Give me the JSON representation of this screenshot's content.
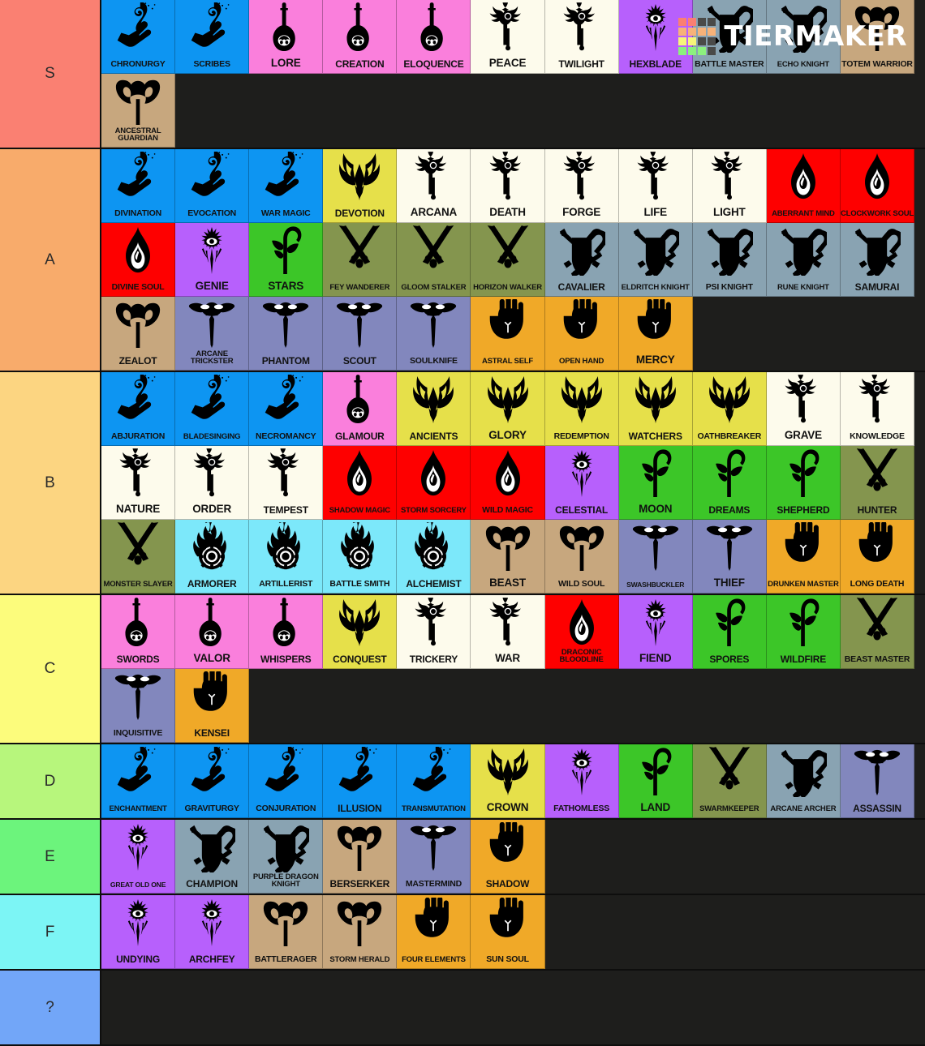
{
  "app": {
    "brand": "TIERMAKER",
    "brand_icon": "tiermaker-logo-grid",
    "logo_grid_colors": [
      "#fa7f72",
      "#fa7f72",
      "#4a4a48",
      "#4a4a48",
      "#f7b279",
      "#f7b279",
      "#f7b279",
      "#f7b279",
      "#f7f579",
      "#f7f579",
      "#4a4a48",
      "#4a4a48",
      "#8cf07e",
      "#8cf07e",
      "#8cf07e",
      "#4a4a48"
    ],
    "background": "#1e1e1c"
  },
  "palette": {
    "wizard": "#0d95f2",
    "bard": "#fa7fdc",
    "cleric": "#fdfbec",
    "warlock": "#b760fc",
    "fighter": "#89a3b2",
    "barbarian": "#c7a77e",
    "paladin": "#e6e04a",
    "sorcerer": "#fe0000",
    "ranger": "#84954e",
    "rogue": "#8287bd",
    "monk": "#f0a928",
    "druid": "#3cc628",
    "artificer": "#7ce8fa"
  },
  "tier_colors": {
    "S": "#fa8072",
    "A": "#f8ab6b",
    "B": "#fcd581",
    "C": "#fcfc7c",
    "D": "#b7f67c",
    "E": "#6cf47c",
    "F": "#7cf5f5",
    "?": "#72a6f8"
  },
  "tiers": [
    {
      "label": "S",
      "color_key": "S",
      "items": [
        {
          "name": "CHRONURGY",
          "class_key": "wizard",
          "icon": "wizard-hand-icon",
          "size": "s3"
        },
        {
          "name": "SCRIBES",
          "class_key": "wizard",
          "icon": "wizard-hand-icon",
          "size": "s3"
        },
        {
          "name": "LORE",
          "class_key": "bard",
          "icon": "bard-lute-icon",
          "size": "s1"
        },
        {
          "name": "CREATION",
          "class_key": "bard",
          "icon": "bard-lute-icon",
          "size": "s2"
        },
        {
          "name": "ELOQUENCE",
          "class_key": "bard",
          "icon": "bard-lute-icon",
          "size": "s2"
        },
        {
          "name": "PEACE",
          "class_key": "cleric",
          "icon": "cleric-mace-icon",
          "size": "s1"
        },
        {
          "name": "TWILIGHT",
          "class_key": "cleric",
          "icon": "cleric-mace-icon",
          "size": "s2"
        },
        {
          "name": "HEXBLADE",
          "class_key": "warlock",
          "icon": "warlock-eye-icon",
          "size": "s2"
        },
        {
          "name": "BATTLE MASTER",
          "class_key": "fighter",
          "icon": "fighter-shield-icon",
          "size": "s3"
        },
        {
          "name": "ECHO KNIGHT",
          "class_key": "fighter",
          "icon": "fighter-shield-icon",
          "size": "s4"
        },
        {
          "name": "TOTEM WARRIOR",
          "class_key": "barbarian",
          "icon": "barbarian-axe-icon",
          "size": "s3"
        },
        {
          "name": "ANCESTRAL GUARDIAN",
          "class_key": "barbarian",
          "icon": "barbarian-axe-icon",
          "size": "s4"
        }
      ]
    },
    {
      "label": "A",
      "color_key": "A",
      "items": [
        {
          "name": "DIVINATION",
          "class_key": "wizard",
          "icon": "wizard-hand-icon",
          "size": "s3"
        },
        {
          "name": "EVOCATION",
          "class_key": "wizard",
          "icon": "wizard-hand-icon",
          "size": "s3"
        },
        {
          "name": "WAR MAGIC",
          "class_key": "wizard",
          "icon": "wizard-hand-icon",
          "size": "s3"
        },
        {
          "name": "DEVOTION",
          "class_key": "paladin",
          "icon": "paladin-helm-icon",
          "size": "s2"
        },
        {
          "name": "ARCANA",
          "class_key": "cleric",
          "icon": "cleric-mace-icon",
          "size": "s1"
        },
        {
          "name": "DEATH",
          "class_key": "cleric",
          "icon": "cleric-mace-icon",
          "size": "s1"
        },
        {
          "name": "FORGE",
          "class_key": "cleric",
          "icon": "cleric-mace-icon",
          "size": "s1"
        },
        {
          "name": "LIFE",
          "class_key": "cleric",
          "icon": "cleric-mace-icon",
          "size": "s1"
        },
        {
          "name": "LIGHT",
          "class_key": "cleric",
          "icon": "cleric-mace-icon",
          "size": "s1"
        },
        {
          "name": "ABERRANT MIND",
          "class_key": "sorcerer",
          "icon": "sorcerer-flame-icon",
          "size": "s4"
        },
        {
          "name": "CLOCKWORK SOUL",
          "class_key": "sorcerer",
          "icon": "sorcerer-flame-icon",
          "size": "s4"
        },
        {
          "name": "DIVINE SOUL",
          "class_key": "sorcerer",
          "icon": "sorcerer-flame-icon",
          "size": "s3"
        },
        {
          "name": "GENIE",
          "class_key": "warlock",
          "icon": "warlock-eye-icon",
          "size": "s1"
        },
        {
          "name": "STARS",
          "class_key": "druid",
          "icon": "druid-staff-icon",
          "size": "s1"
        },
        {
          "name": "FEY WANDERER",
          "class_key": "ranger",
          "icon": "ranger-arrows-icon",
          "size": "s4"
        },
        {
          "name": "GLOOM STALKER",
          "class_key": "ranger",
          "icon": "ranger-arrows-icon",
          "size": "s4"
        },
        {
          "name": "HORIZON WALKER",
          "class_key": "ranger",
          "icon": "ranger-arrows-icon",
          "size": "s4"
        },
        {
          "name": "CAVALIER",
          "class_key": "fighter",
          "icon": "fighter-shield-icon",
          "size": "s2"
        },
        {
          "name": "ELDRITCH KNIGHT",
          "class_key": "fighter",
          "icon": "fighter-shield-icon",
          "size": "s4"
        },
        {
          "name": "PSI KNIGHT",
          "class_key": "fighter",
          "icon": "fighter-shield-icon",
          "size": "s3"
        },
        {
          "name": "RUNE KNIGHT",
          "class_key": "fighter",
          "icon": "fighter-shield-icon",
          "size": "s4"
        },
        {
          "name": "SAMURAI",
          "class_key": "fighter",
          "icon": "fighter-shield-icon",
          "size": "s2"
        },
        {
          "name": "ZEALOT",
          "class_key": "barbarian",
          "icon": "barbarian-axe-icon",
          "size": "s2"
        },
        {
          "name": "ARCANE TRICKSTER",
          "class_key": "rogue",
          "icon": "rogue-dagger-icon",
          "size": "s4"
        },
        {
          "name": "PHANTOM",
          "class_key": "rogue",
          "icon": "rogue-dagger-icon",
          "size": "s2"
        },
        {
          "name": "SCOUT",
          "class_key": "rogue",
          "icon": "rogue-dagger-icon",
          "size": "s2"
        },
        {
          "name": "SOULKNIFE",
          "class_key": "rogue",
          "icon": "rogue-dagger-icon",
          "size": "s3"
        },
        {
          "name": "ASTRAL SELF",
          "class_key": "monk",
          "icon": "monk-fist-icon",
          "size": "s4"
        },
        {
          "name": "OPEN HAND",
          "class_key": "monk",
          "icon": "monk-fist-icon",
          "size": "s4"
        },
        {
          "name": "MERCY",
          "class_key": "monk",
          "icon": "monk-fist-icon",
          "size": "s1"
        }
      ]
    },
    {
      "label": "B",
      "color_key": "B",
      "items": [
        {
          "name": "ABJURATION",
          "class_key": "wizard",
          "icon": "wizard-hand-icon",
          "size": "s3"
        },
        {
          "name": "BLADESINGING",
          "class_key": "wizard",
          "icon": "wizard-hand-icon",
          "size": "s4"
        },
        {
          "name": "NECROMANCY",
          "class_key": "wizard",
          "icon": "wizard-hand-icon",
          "size": "s3"
        },
        {
          "name": "GLAMOUR",
          "class_key": "bard",
          "icon": "bard-lute-icon",
          "size": "s2"
        },
        {
          "name": "ANCIENTS",
          "class_key": "paladin",
          "icon": "paladin-helm-icon",
          "size": "s2"
        },
        {
          "name": "GLORY",
          "class_key": "paladin",
          "icon": "paladin-helm-icon",
          "size": "s1"
        },
        {
          "name": "REDEMPTION",
          "class_key": "paladin",
          "icon": "paladin-helm-icon",
          "size": "s3"
        },
        {
          "name": "WATCHERS",
          "class_key": "paladin",
          "icon": "paladin-helm-icon",
          "size": "s2"
        },
        {
          "name": "OATHBREAKER",
          "class_key": "paladin",
          "icon": "paladin-helm-icon",
          "size": "s3"
        },
        {
          "name": "GRAVE",
          "class_key": "cleric",
          "icon": "cleric-mace-icon",
          "size": "s1"
        },
        {
          "name": "KNOWLEDGE",
          "class_key": "cleric",
          "icon": "cleric-mace-icon",
          "size": "s3"
        },
        {
          "name": "NATURE",
          "class_key": "cleric",
          "icon": "cleric-mace-icon",
          "size": "s1"
        },
        {
          "name": "ORDER",
          "class_key": "cleric",
          "icon": "cleric-mace-icon",
          "size": "s1"
        },
        {
          "name": "TEMPEST",
          "class_key": "cleric",
          "icon": "cleric-mace-icon",
          "size": "s2"
        },
        {
          "name": "SHADOW MAGIC",
          "class_key": "sorcerer",
          "icon": "sorcerer-flame-icon",
          "size": "s4"
        },
        {
          "name": "STORM SORCERY",
          "class_key": "sorcerer",
          "icon": "sorcerer-flame-icon",
          "size": "s4"
        },
        {
          "name": "WILD MAGIC",
          "class_key": "sorcerer",
          "icon": "sorcerer-flame-icon",
          "size": "s3"
        },
        {
          "name": "CELESTIAL",
          "class_key": "warlock",
          "icon": "warlock-eye-icon",
          "size": "s2"
        },
        {
          "name": "MOON",
          "class_key": "druid",
          "icon": "druid-staff-icon",
          "size": "s1"
        },
        {
          "name": "DREAMS",
          "class_key": "druid",
          "icon": "druid-staff-icon",
          "size": "s2"
        },
        {
          "name": "SHEPHERD",
          "class_key": "druid",
          "icon": "druid-staff-icon",
          "size": "s2"
        },
        {
          "name": "HUNTER",
          "class_key": "ranger",
          "icon": "ranger-arrows-icon",
          "size": "s2"
        },
        {
          "name": "MONSTER SLAYER",
          "class_key": "ranger",
          "icon": "ranger-arrows-icon",
          "size": "s4"
        },
        {
          "name": "ARMORER",
          "class_key": "artificer",
          "icon": "artificer-gear-icon",
          "size": "s2"
        },
        {
          "name": "ARTILLERIST",
          "class_key": "artificer",
          "icon": "artificer-gear-icon",
          "size": "s3"
        },
        {
          "name": "BATTLE SMITH",
          "class_key": "artificer",
          "icon": "artificer-gear-icon",
          "size": "s3"
        },
        {
          "name": "ALCHEMIST",
          "class_key": "artificer",
          "icon": "artificer-gear-icon",
          "size": "s2"
        },
        {
          "name": "BEAST",
          "class_key": "barbarian",
          "icon": "barbarian-axe-icon",
          "size": "s1"
        },
        {
          "name": "WILD SOUL",
          "class_key": "barbarian",
          "icon": "barbarian-axe-icon",
          "size": "s3"
        },
        {
          "name": "SWASHBUCKLER",
          "class_key": "rogue",
          "icon": "rogue-dagger-icon",
          "size": "s5"
        },
        {
          "name": "THIEF",
          "class_key": "rogue",
          "icon": "rogue-dagger-icon",
          "size": "s1"
        },
        {
          "name": "DRUNKEN MASTER",
          "class_key": "monk",
          "icon": "monk-fist-icon",
          "size": "s4"
        },
        {
          "name": "LONG DEATH",
          "class_key": "monk",
          "icon": "monk-fist-icon",
          "size": "s3"
        }
      ]
    },
    {
      "label": "C",
      "color_key": "C",
      "items": [
        {
          "name": "SWORDS",
          "class_key": "bard",
          "icon": "bard-lute-icon",
          "size": "s2"
        },
        {
          "name": "VALOR",
          "class_key": "bard",
          "icon": "bard-lute-icon",
          "size": "s1"
        },
        {
          "name": "WHISPERS",
          "class_key": "bard",
          "icon": "bard-lute-icon",
          "size": "s2"
        },
        {
          "name": "CONQUEST",
          "class_key": "paladin",
          "icon": "paladin-helm-icon",
          "size": "s2"
        },
        {
          "name": "TRICKERY",
          "class_key": "cleric",
          "icon": "cleric-mace-icon",
          "size": "s2"
        },
        {
          "name": "WAR",
          "class_key": "cleric",
          "icon": "cleric-mace-icon",
          "size": "s1"
        },
        {
          "name": "DRACONIC BLOODLINE",
          "class_key": "sorcerer",
          "icon": "sorcerer-flame-icon",
          "size": "s4"
        },
        {
          "name": "FIEND",
          "class_key": "warlock",
          "icon": "warlock-eye-icon",
          "size": "s1"
        },
        {
          "name": "SPORES",
          "class_key": "druid",
          "icon": "druid-staff-icon",
          "size": "s2"
        },
        {
          "name": "WILDFIRE",
          "class_key": "druid",
          "icon": "druid-staff-icon",
          "size": "s2"
        },
        {
          "name": "BEAST MASTER",
          "class_key": "ranger",
          "icon": "ranger-arrows-icon",
          "size": "s3"
        },
        {
          "name": "INQUISITIVE",
          "class_key": "rogue",
          "icon": "rogue-dagger-icon",
          "size": "s3"
        },
        {
          "name": "KENSEI",
          "class_key": "monk",
          "icon": "monk-fist-icon",
          "size": "s2"
        }
      ]
    },
    {
      "label": "D",
      "color_key": "D",
      "items": [
        {
          "name": "ENCHANTMENT",
          "class_key": "wizard",
          "icon": "wizard-hand-icon",
          "size": "s4"
        },
        {
          "name": "GRAVITURGY",
          "class_key": "wizard",
          "icon": "wizard-hand-icon",
          "size": "s3"
        },
        {
          "name": "CONJURATION",
          "class_key": "wizard",
          "icon": "wizard-hand-icon",
          "size": "s3"
        },
        {
          "name": "ILLUSION",
          "class_key": "wizard",
          "icon": "wizard-hand-icon",
          "size": "s2"
        },
        {
          "name": "TRANSMUTATION",
          "class_key": "wizard",
          "icon": "wizard-hand-icon",
          "size": "s4"
        },
        {
          "name": "CROWN",
          "class_key": "paladin",
          "icon": "paladin-helm-icon",
          "size": "s1"
        },
        {
          "name": "FATHOMLESS",
          "class_key": "warlock",
          "icon": "warlock-eye-icon",
          "size": "s3"
        },
        {
          "name": "LAND",
          "class_key": "druid",
          "icon": "druid-staff-icon",
          "size": "s1"
        },
        {
          "name": "SWARMKEEPER",
          "class_key": "ranger",
          "icon": "ranger-arrows-icon",
          "size": "s4"
        },
        {
          "name": "ARCANE ARCHER",
          "class_key": "fighter",
          "icon": "fighter-shield-icon",
          "size": "s4"
        },
        {
          "name": "ASSASSIN",
          "class_key": "rogue",
          "icon": "rogue-dagger-icon",
          "size": "s2"
        }
      ]
    },
    {
      "label": "E",
      "color_key": "E",
      "items": [
        {
          "name": "GREAT OLD ONE",
          "class_key": "warlock",
          "icon": "warlock-eye-icon",
          "size": "s5"
        },
        {
          "name": "CHAMPION",
          "class_key": "fighter",
          "icon": "fighter-shield-icon",
          "size": "s2"
        },
        {
          "name": "PURPLE DRAGON KNIGHT",
          "class_key": "fighter",
          "icon": "fighter-shield-icon",
          "size": "s4"
        },
        {
          "name": "BERSERKER",
          "class_key": "barbarian",
          "icon": "barbarian-axe-icon",
          "size": "s2"
        },
        {
          "name": "MASTERMIND",
          "class_key": "rogue",
          "icon": "rogue-dagger-icon",
          "size": "s3"
        },
        {
          "name": "SHADOW",
          "class_key": "monk",
          "icon": "monk-fist-icon",
          "size": "s2"
        }
      ]
    },
    {
      "label": "F",
      "color_key": "F",
      "items": [
        {
          "name": "UNDYING",
          "class_key": "warlock",
          "icon": "warlock-eye-icon",
          "size": "s2"
        },
        {
          "name": "ARCHFEY",
          "class_key": "warlock",
          "icon": "warlock-eye-icon",
          "size": "s2"
        },
        {
          "name": "BATTLERAGER",
          "class_key": "barbarian",
          "icon": "barbarian-axe-icon",
          "size": "s3"
        },
        {
          "name": "STORM HERALD",
          "class_key": "barbarian",
          "icon": "barbarian-axe-icon",
          "size": "s4"
        },
        {
          "name": "FOUR ELEMENTS",
          "class_key": "monk",
          "icon": "monk-fist-icon",
          "size": "s4"
        },
        {
          "name": "SUN SOUL",
          "class_key": "monk",
          "icon": "monk-fist-icon",
          "size": "s3"
        }
      ]
    },
    {
      "label": "?",
      "color_key": "?",
      "items": []
    }
  ]
}
